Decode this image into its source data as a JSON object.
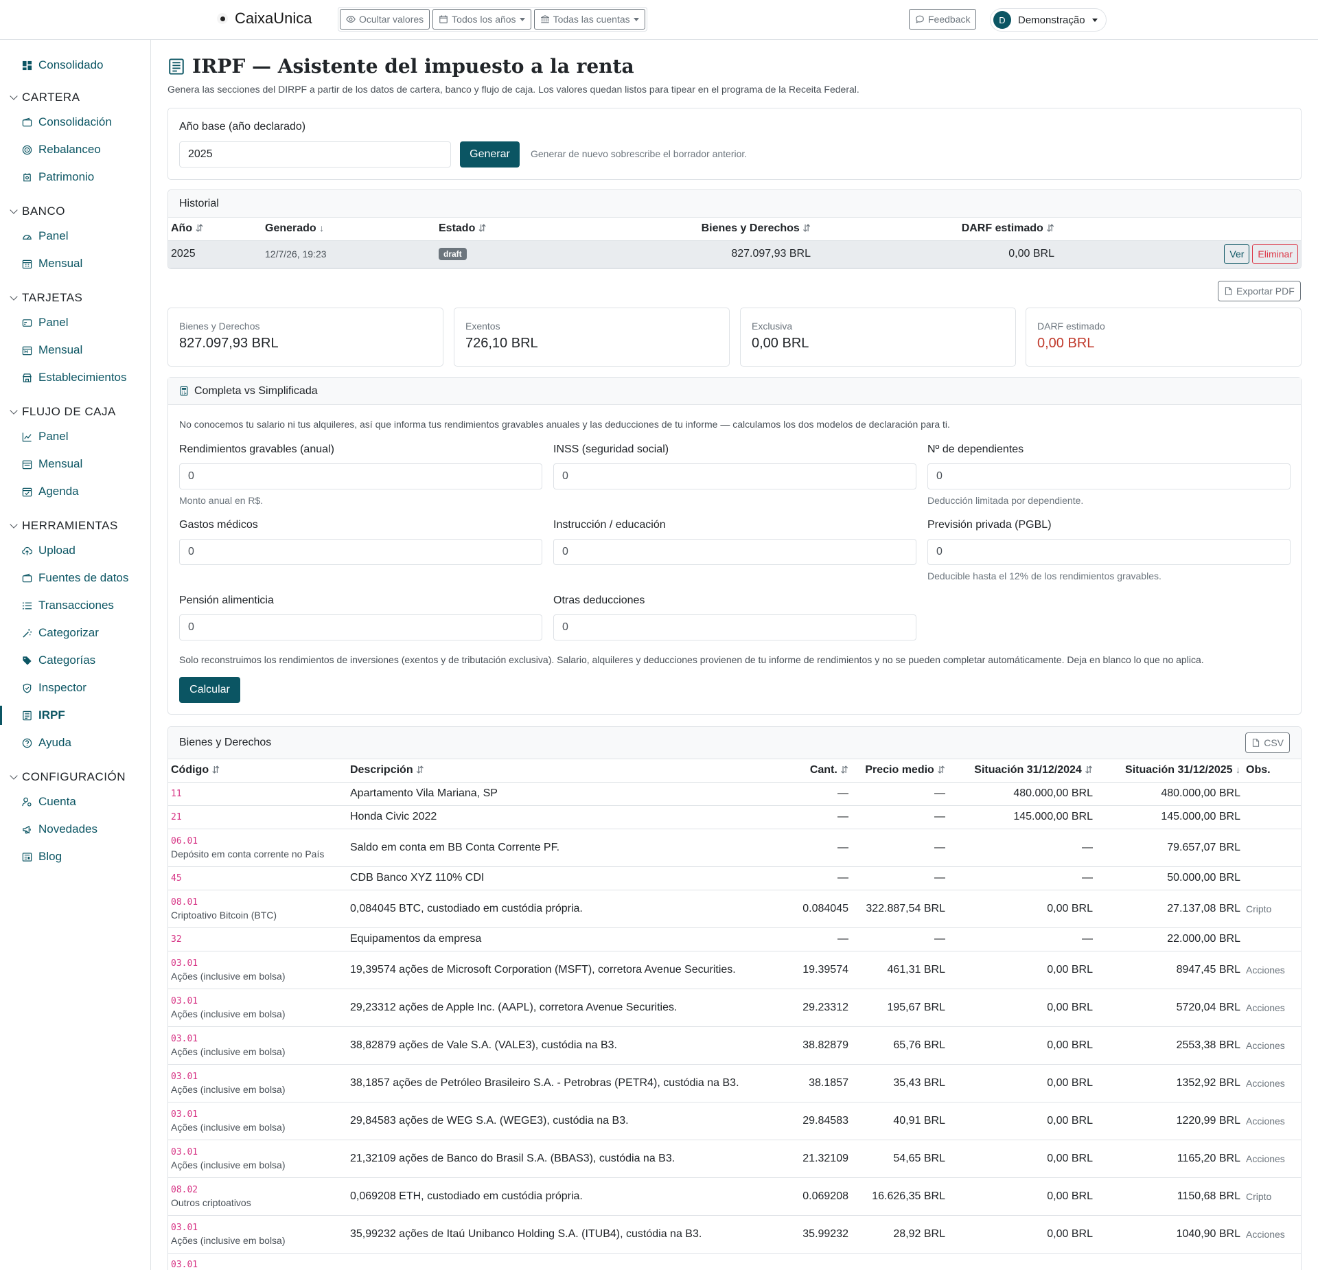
{
  "topbar": {
    "brand": "CaixaUnica",
    "hide_values": "Ocultar valores",
    "all_years": "Todos los años",
    "all_accounts": "Todas las cuentas",
    "feedback": "Feedback",
    "user_initial": "D",
    "user_name": "Demonstração"
  },
  "sidebar": {
    "consolidado": "Consolidado",
    "sections": [
      {
        "title": "CARTERA",
        "items": [
          "Consolidación",
          "Rebalanceo",
          "Patrimonio"
        ]
      },
      {
        "title": "BANCO",
        "items": [
          "Panel",
          "Mensual"
        ]
      },
      {
        "title": "TARJETAS",
        "items": [
          "Panel",
          "Mensual",
          "Establecimientos"
        ]
      },
      {
        "title": "FLUJO DE CAJA",
        "items": [
          "Panel",
          "Mensual",
          "Agenda"
        ]
      },
      {
        "title": "HERRAMIENTAS",
        "items": [
          "Upload",
          "Fuentes de datos",
          "Transacciones",
          "Categorizar",
          "Categorías",
          "Inspector",
          "IRPF",
          "Ayuda"
        ]
      },
      {
        "title": "CONFIGURACIÓN",
        "items": [
          "Cuenta",
          "Novedades",
          "Blog"
        ]
      }
    ]
  },
  "page": {
    "title": "IRPF — Asistente del impuesto a la renta",
    "subtitle": "Genera las secciones del DIRPF a partir de los datos de cartera, banco y flujo de caja. Los valores quedan listos para tipear en el programa de la Receita Federal."
  },
  "base_year": {
    "label": "Año base (año declarado)",
    "value": "2025",
    "button": "Generar",
    "help": "Generar de nuevo sobrescribe el borrador anterior."
  },
  "history": {
    "title": "Historial",
    "headers": [
      "Año",
      "Generado",
      "Estado",
      "Bienes y Derechos",
      "DARF estimado"
    ],
    "row": {
      "year": "2025",
      "generated": "12/7/26, 19:23",
      "status": "draft",
      "assets": "827.097,93 BRL",
      "darf": "0,00 BRL",
      "view": "Ver",
      "delete": "Eliminar"
    }
  },
  "export_pdf": "Exportar PDF",
  "stats": [
    {
      "label": "Bienes y Derechos",
      "value": "827.097,93 BRL"
    },
    {
      "label": "Exentos",
      "value": "726,10 BRL"
    },
    {
      "label": "Exclusiva",
      "value": "0,00 BRL"
    },
    {
      "label": "DARF estimado",
      "value": "0,00 BRL"
    }
  ],
  "comparison": {
    "title": "Completa vs Simplificada",
    "intro": "No conocemos tu salario ni tus alquileres, así que informa tus rendimientos gravables anuales y las deducciones de tu informe — calculamos los dos modelos de declaración para ti.",
    "fields": [
      {
        "label": "Rendimientos gravables (anual)",
        "value": "0",
        "help": "Monto anual en R$."
      },
      {
        "label": "INSS (seguridad social)",
        "value": "0",
        "help": ""
      },
      {
        "label": "Nº de dependientes",
        "value": "0",
        "help": "Deducción limitada por dependiente."
      },
      {
        "label": "Gastos médicos",
        "value": "0",
        "help": ""
      },
      {
        "label": "Instrucción / educación",
        "value": "0",
        "help": ""
      },
      {
        "label": "Previsión privada (PGBL)",
        "value": "0",
        "help": "Deducible hasta el 12% de los rendimientos gravables."
      },
      {
        "label": "Pensión alimenticia",
        "value": "0",
        "help": ""
      },
      {
        "label": "Otras deducciones",
        "value": "0",
        "help": ""
      }
    ],
    "note": "Solo reconstruimos los rendimientos de inversiones (exentos y de tributación exclusiva). Salario, alquileres y deducciones provienen de tu informe de rendimientos y no se pueden completar automáticamente. Deja en blanco lo que no aplica.",
    "button": "Calcular"
  },
  "assets": {
    "title": "Bienes y Derechos",
    "csv": "CSV",
    "headers": [
      "Código",
      "Descripción",
      "Cant.",
      "Precio medio",
      "Situación 31/12/2024",
      "Situación 31/12/2025",
      "Obs."
    ],
    "rows": [
      {
        "code": "11",
        "sub": "",
        "desc": "Apartamento Vila Mariana, SP",
        "qty": "—",
        "price": "—",
        "s2024": "480.000,00 BRL",
        "s2025": "480.000,00 BRL",
        "obs": ""
      },
      {
        "code": "21",
        "sub": "",
        "desc": "Honda Civic 2022",
        "qty": "—",
        "price": "—",
        "s2024": "145.000,00 BRL",
        "s2025": "145.000,00 BRL",
        "obs": ""
      },
      {
        "code": "06.01",
        "sub": "Depósito em conta corrente no País",
        "desc": "Saldo em conta em BB Conta Corrente PF.",
        "qty": "—",
        "price": "—",
        "s2024": "—",
        "s2025": "79.657,07 BRL",
        "obs": ""
      },
      {
        "code": "45",
        "sub": "",
        "desc": "CDB Banco XYZ 110% CDI",
        "qty": "—",
        "price": "—",
        "s2024": "—",
        "s2025": "50.000,00 BRL",
        "obs": ""
      },
      {
        "code": "08.01",
        "sub": "Criptoativo Bitcoin (BTC)",
        "desc": "0,084045 BTC, custodiado em custódia própria.",
        "qty": "0.084045",
        "price": "322.887,54 BRL",
        "s2024": "0,00 BRL",
        "s2025": "27.137,08 BRL",
        "obs": "Cripto"
      },
      {
        "code": "32",
        "sub": "",
        "desc": "Equipamentos da empresa",
        "qty": "—",
        "price": "—",
        "s2024": "—",
        "s2025": "22.000,00 BRL",
        "obs": ""
      },
      {
        "code": "03.01",
        "sub": "Ações (inclusive em bolsa)",
        "desc": "19,39574 ações de Microsoft Corporation (MSFT), corretora Avenue Securities.",
        "qty": "19.39574",
        "price": "461,31 BRL",
        "s2024": "0,00 BRL",
        "s2025": "8947,45 BRL",
        "obs": "Acciones"
      },
      {
        "code": "03.01",
        "sub": "Ações (inclusive em bolsa)",
        "desc": "29,23312 ações de Apple Inc. (AAPL), corretora Avenue Securities.",
        "qty": "29.23312",
        "price": "195,67 BRL",
        "s2024": "0,00 BRL",
        "s2025": "5720,04 BRL",
        "obs": "Acciones"
      },
      {
        "code": "03.01",
        "sub": "Ações (inclusive em bolsa)",
        "desc": "38,82879 ações de Vale S.A. (VALE3), custódia na B3.",
        "qty": "38.82879",
        "price": "65,76 BRL",
        "s2024": "0,00 BRL",
        "s2025": "2553,38 BRL",
        "obs": "Acciones"
      },
      {
        "code": "03.01",
        "sub": "Ações (inclusive em bolsa)",
        "desc": "38,1857 ações de Petróleo Brasileiro S.A. - Petrobras (PETR4), custódia na B3.",
        "qty": "38.1857",
        "price": "35,43 BRL",
        "s2024": "0,00 BRL",
        "s2025": "1352,92 BRL",
        "obs": "Acciones"
      },
      {
        "code": "03.01",
        "sub": "Ações (inclusive em bolsa)",
        "desc": "29,84583 ações de WEG S.A. (WEGE3), custódia na B3.",
        "qty": "29.84583",
        "price": "40,91 BRL",
        "s2024": "0,00 BRL",
        "s2025": "1220,99 BRL",
        "obs": "Acciones"
      },
      {
        "code": "03.01",
        "sub": "Ações (inclusive em bolsa)",
        "desc": "21,32109 ações de Banco do Brasil S.A. (BBAS3), custódia na B3.",
        "qty": "21.32109",
        "price": "54,65 BRL",
        "s2024": "0,00 BRL",
        "s2025": "1165,20 BRL",
        "obs": "Acciones"
      },
      {
        "code": "08.02",
        "sub": "Outros criptoativos",
        "desc": "0,069208 ETH, custodiado em custódia própria.",
        "qty": "0.069208",
        "price": "16.626,35 BRL",
        "s2024": "0,00 BRL",
        "s2025": "1150,68 BRL",
        "obs": "Cripto"
      },
      {
        "code": "03.01",
        "sub": "Ações (inclusive em bolsa)",
        "desc": "35,99232 ações de Itaú Unibanco Holding S.A. (ITUB4), custódia na B3.",
        "qty": "35.99232",
        "price": "28,92 BRL",
        "s2024": "0,00 BRL",
        "s2025": "1040,90 BRL",
        "obs": "Acciones"
      },
      {
        "code": "03.01",
        "sub": "",
        "desc": "",
        "qty": "",
        "price": "",
        "s2024": "",
        "s2025": "",
        "obs": ""
      }
    ]
  }
}
